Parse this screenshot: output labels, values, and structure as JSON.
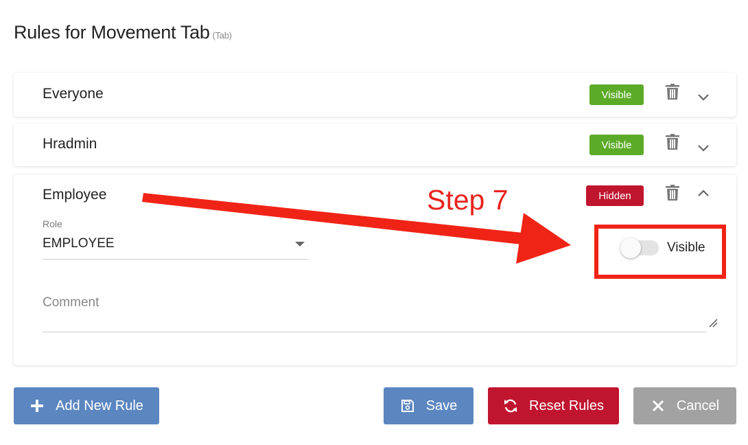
{
  "header": {
    "title": "Rules for Movement Tab",
    "subtitle": "(Tab)"
  },
  "rules": [
    {
      "name": "Everyone",
      "status": "Visible",
      "status_color": "#5cab28",
      "expanded": false
    },
    {
      "name": "Hradmin",
      "status": "Visible",
      "status_color": "#5cab28",
      "expanded": false
    },
    {
      "name": "Employee",
      "status": "Hidden",
      "status_color": "#c0152f",
      "expanded": true,
      "role_label": "Role",
      "role_value": "EMPLOYEE",
      "toggle_label": "Visible",
      "toggle_on": false,
      "comment_placeholder": "Comment"
    }
  ],
  "footer": {
    "add_label": "Add New Rule",
    "save_label": "Save",
    "reset_label": "Reset Rules",
    "cancel_label": "Cancel"
  },
  "annotation": {
    "text": "Step 7",
    "color": "#e8231d"
  },
  "icons": {
    "trash": "trash-icon",
    "chevron_down": "chevron-down-icon",
    "chevron_up": "chevron-up-icon",
    "plus": "plus-icon",
    "save": "floppy-disk-icon",
    "reset": "refresh-icon",
    "cancel": "close-icon"
  },
  "colors": {
    "primary": "#5b86c0",
    "danger": "#c0152f",
    "success": "#5cab28",
    "neutral": "#a2a2a2"
  }
}
